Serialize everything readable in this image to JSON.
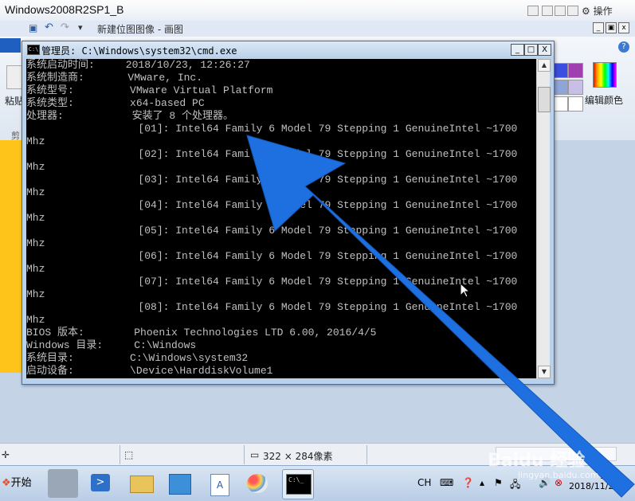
{
  "vm": {
    "title": "Windows2008R2SP1_B",
    "action_label": "操作"
  },
  "paint": {
    "title": "新建位图图像 - 画图",
    "paste_label": "粘贴",
    "cut_label": "剪",
    "edit_colors_label": "编辑颜色",
    "status_size": "322 × 284像素"
  },
  "cmd": {
    "title": "管理员: C:\\Windows\\system32\\cmd.exe",
    "minimize": "_",
    "maximize": "□",
    "close": "X",
    "lines": [
      "系统启动时间:     2018/10/23, 12:26:27",
      "系统制造商:       VMware, Inc.",
      "系统型号:         VMware Virtual Platform",
      "系统类型:         x64-based PC",
      "处理器:           安装了 8 个处理器。",
      "                  [01]: Intel64 Family 6 Model 79 Stepping 1 GenuineIntel ~1700",
      "Mhz",
      "                  [02]: Intel64 Family 6 Model 79 Stepping 1 GenuineIntel ~1700",
      "Mhz",
      "                  [03]: Intel64 Family 6 Model 79 Stepping 1 GenuineIntel ~1700",
      "Mhz",
      "                  [04]: Intel64 Family 6 Model 79 Stepping 1 GenuineIntel ~1700",
      "Mhz",
      "                  [05]: Intel64 Family 6 Model 79 Stepping 1 GenuineIntel ~1700",
      "Mhz",
      "                  [06]: Intel64 Family 6 Model 79 Stepping 1 GenuineIntel ~1700",
      "Mhz",
      "                  [07]: Intel64 Family 6 Model 79 Stepping 1 GenuineIntel ~1700",
      "Mhz",
      "                  [08]: Intel64 Family 6 Model 79 Stepping 1 GenuineIntel ~1700",
      "Mhz",
      "BIOS 版本:        Phoenix Technologies LTD 6.00, 2016/4/5",
      "Windows 目录:     C:\\Windows",
      "系统目录:         C:\\Windows\\system32",
      "启动设备:         \\Device\\HarddiskVolume1"
    ]
  },
  "taskbar": {
    "start_label": "开始",
    "ime_label": "CH",
    "clock_time": "19:",
    "clock_date": "2018/11/2"
  },
  "watermark": {
    "brand": "Baidu 经验",
    "url": "jingyan.baidu.com"
  },
  "colors": {
    "arrow": "#1e6fe0",
    "console_bg": "#000000",
    "console_text": "#c0c0c0"
  }
}
